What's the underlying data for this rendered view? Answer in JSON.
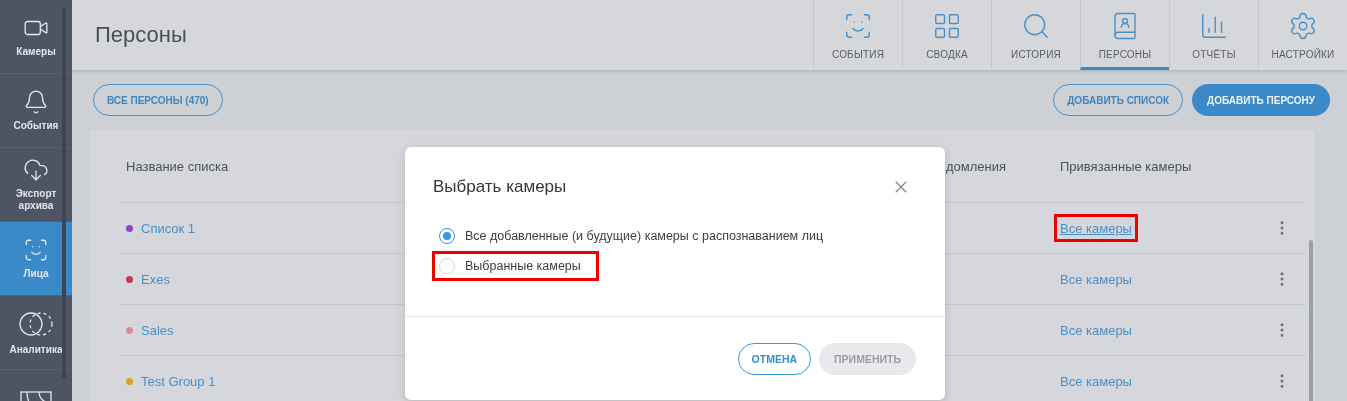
{
  "sidebar": {
    "items": [
      {
        "label": "Камеры",
        "selected": false
      },
      {
        "label": "События",
        "selected": false
      },
      {
        "label": "Экспорт архива",
        "selected": false
      },
      {
        "label": "Лица",
        "selected": true
      },
      {
        "label": "Аналитика",
        "selected": false
      },
      {
        "selected": false
      }
    ]
  },
  "page_title": "Персоны",
  "tabs": [
    {
      "label": "СОБЫТИЯ",
      "selected": false
    },
    {
      "label": "СВОДКА",
      "selected": false
    },
    {
      "label": "ИСТОРИЯ",
      "selected": false
    },
    {
      "label": "ПЕРСОНЫ",
      "selected": true
    },
    {
      "label": "ОТЧЁТЫ",
      "selected": false
    },
    {
      "label": "НАСТРОЙКИ",
      "selected": false
    }
  ],
  "toolbar": {
    "all_persons": "ВСЕ ПЕРСОНЫ (470)",
    "add_list": "ДОБАВИТЬ СПИСОК",
    "add_person": "ДОБАВИТЬ ПЕРСОНУ"
  },
  "table": {
    "columns": [
      "Название списка",
      "домления",
      "Привязанные камеры"
    ],
    "rows": [
      {
        "name": "Список 1",
        "color": "#8e3fd0",
        "cameras": "Все камеры",
        "highlighted": true
      },
      {
        "name": "Exes",
        "color": "#c23a57",
        "cameras": "Все камеры",
        "highlighted": false
      },
      {
        "name": "Sales",
        "color": "#d88ca0",
        "cameras": "Все камеры",
        "highlighted": false
      },
      {
        "name": "Test Group 1",
        "color": "#d4a42a",
        "cameras": "Все камеры",
        "highlighted": false
      }
    ]
  },
  "dialog": {
    "title": "Выбрать камеры",
    "options": [
      {
        "label": "Все добавленные (и будущие) камеры с распознаванием лиц",
        "selected": true,
        "highlighted": false
      },
      {
        "label": "Выбранные камеры",
        "selected": false,
        "highlighted": true
      }
    ],
    "cancel": "ОТМЕНА",
    "apply": {
      "label": "ПРИМЕНИТЬ",
      "disabled": true
    }
  }
}
